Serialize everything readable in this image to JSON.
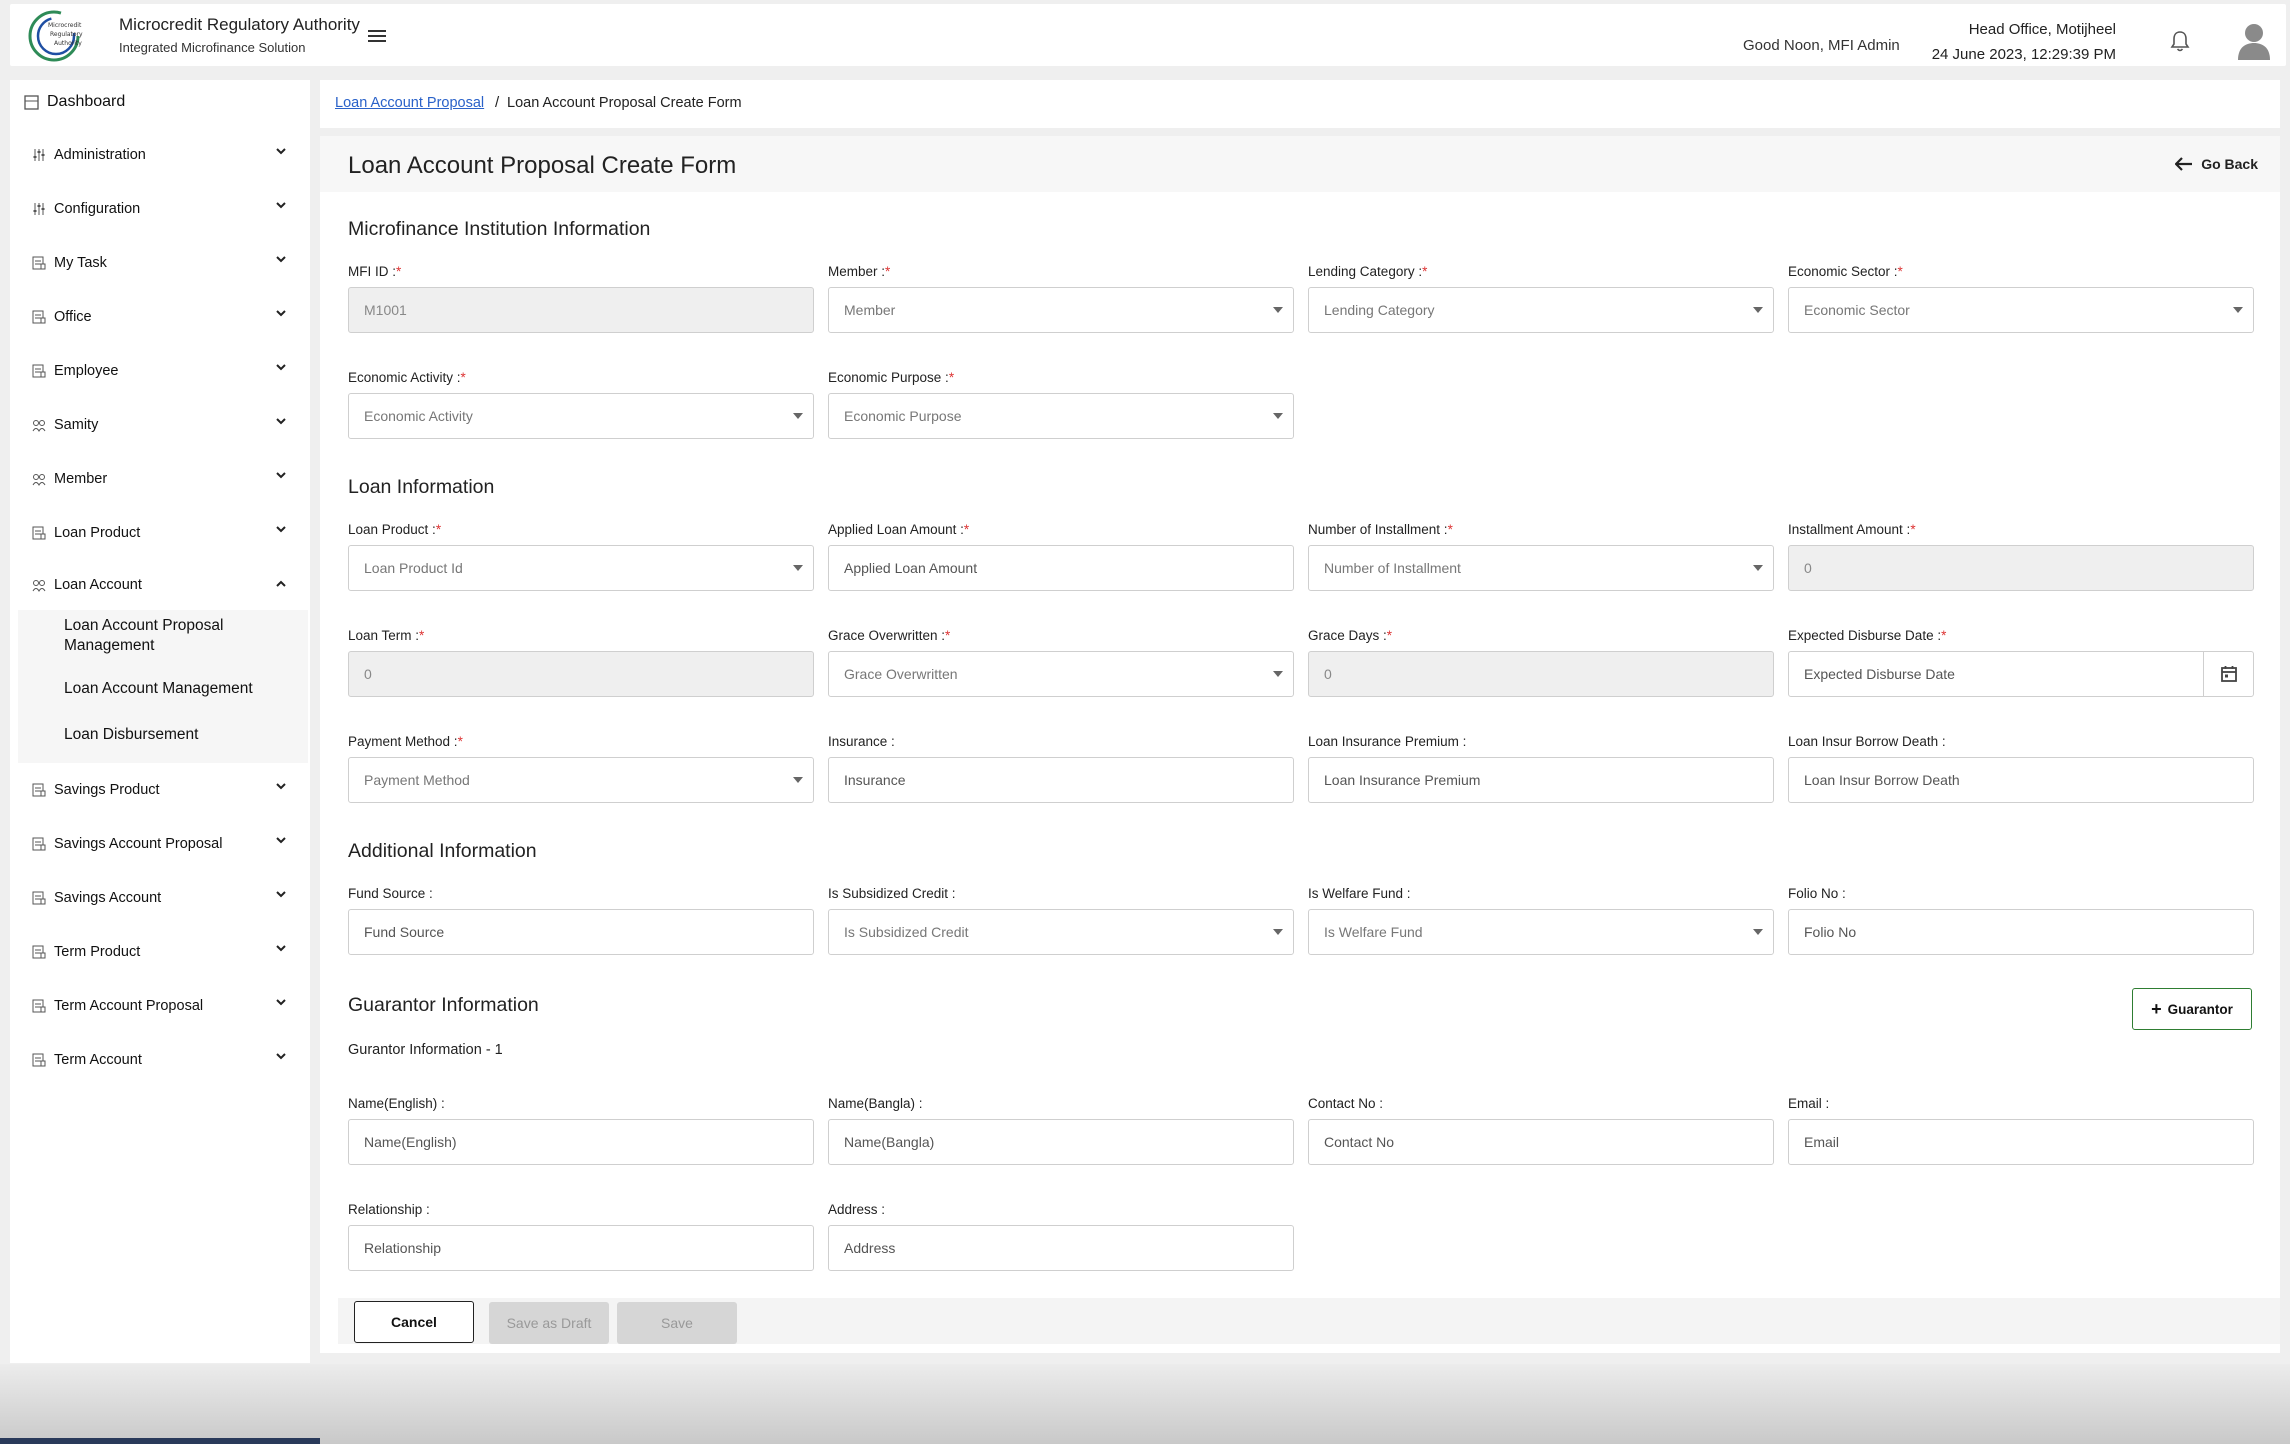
{
  "header": {
    "org_name": "Microcredit Regulatory Authority",
    "org_sub": "Integrated Microfinance Solution",
    "logo_text": [
      "Microcredit",
      "Regulatory",
      "Authority"
    ],
    "greeting": "Good Noon, MFI Admin",
    "office": "Head Office, Motijheel",
    "datetime": "24 June 2023, 12:29:39 PM"
  },
  "sidebar": {
    "dashboard": "Dashboard",
    "items": [
      {
        "label": "Administration",
        "icon": "sliders-icon"
      },
      {
        "label": "Configuration",
        "icon": "sliders-icon"
      },
      {
        "label": "My Task",
        "icon": "doc-icon"
      },
      {
        "label": "Office",
        "icon": "doc-icon"
      },
      {
        "label": "Employee",
        "icon": "doc-icon"
      },
      {
        "label": "Samity",
        "icon": "group-icon"
      },
      {
        "label": "Member",
        "icon": "group-icon"
      },
      {
        "label": "Loan Product",
        "icon": "doc-icon"
      },
      {
        "label": "Loan Account",
        "icon": "group-icon"
      }
    ],
    "loan_account_sub": [
      "Loan Account Proposal Management",
      "Loan Account Management",
      "Loan Disbursement"
    ],
    "items_after": [
      {
        "label": "Savings Product"
      },
      {
        "label": "Savings Account Proposal"
      },
      {
        "label": "Savings Account"
      },
      {
        "label": "Term Product"
      },
      {
        "label": "Term Account Proposal"
      },
      {
        "label": "Term Account"
      }
    ]
  },
  "breadcrumb": {
    "link": "Loan Account Proposal",
    "separator": "/",
    "current": "Loan Account Proposal Create Form"
  },
  "form": {
    "title": "Loan Account Proposal Create Form",
    "go_back": "Go Back",
    "sections": {
      "mfi": "Microfinance Institution Information",
      "loan": "Loan Information",
      "additional": "Additional Information",
      "guarantor": "Guarantor Information"
    },
    "labels": {
      "mfi_id": "MFI ID :",
      "member": "Member :",
      "lending_category": "Lending Category :",
      "economic_sector": "Economic Sector :",
      "economic_activity": "Economic Activity :",
      "economic_purpose": "Economic Purpose :",
      "loan_product": "Loan Product :",
      "applied_loan_amount": "Applied Loan Amount :",
      "number_of_installment": "Number of Installment :",
      "installment_amount": "Installment Amount :",
      "loan_term": "Loan Term :",
      "grace_overwritten": "Grace Overwritten :",
      "grace_days": "Grace Days :",
      "expected_disburse_date": "Expected Disburse Date :",
      "payment_method": "Payment Method :",
      "insurance": "Insurance :",
      "loan_insurance_premium": "Loan Insurance Premium :",
      "loan_insur_borrow_death": "Loan Insur Borrow Death :",
      "fund_source": "Fund Source :",
      "is_subsidized_credit": "Is Subsidized Credit :",
      "is_welfare_fund": "Is Welfare Fund :",
      "folio_no": "Folio No :",
      "name_english": "Name(English) :",
      "name_bangla": "Name(Bangla) :",
      "contact_no": "Contact No :",
      "email": "Email :",
      "relationship": "Relationship :",
      "address": "Address :"
    },
    "required_mark": "*",
    "values": {
      "mfi_id": "M1001",
      "member": "Member",
      "lending_category": "Lending Category",
      "economic_sector": "Economic Sector",
      "economic_activity": "Economic Activity",
      "economic_purpose": "Economic Purpose",
      "loan_product": "Loan Product Id",
      "applied_loan_amount": "Applied Loan Amount",
      "number_of_installment": "Number of Installment",
      "installment_amount": "0",
      "loan_term": "0",
      "grace_overwritten": "Grace Overwritten",
      "grace_days": "0",
      "expected_disburse_date": "Expected Disburse Date",
      "payment_method": "Payment Method",
      "insurance": "Insurance",
      "loan_insurance_premium": "Loan Insurance Premium",
      "loan_insur_borrow_death": "Loan Insur Borrow Death",
      "fund_source": "Fund Source",
      "is_subsidized_credit": "Is Subsidized Credit",
      "is_welfare_fund": "Is Welfare Fund",
      "folio_no": "Folio No",
      "name_english": "Name(English)",
      "name_bangla": "Name(Bangla)",
      "contact_no": "Contact No",
      "email": "Email",
      "relationship": "Relationship",
      "address": "Address"
    },
    "guarantor_button": "Guarantor",
    "guarantor_sub": "Gurantor Information - 1",
    "buttons": {
      "cancel": "Cancel",
      "draft": "Save as Draft",
      "save": "Save"
    }
  }
}
